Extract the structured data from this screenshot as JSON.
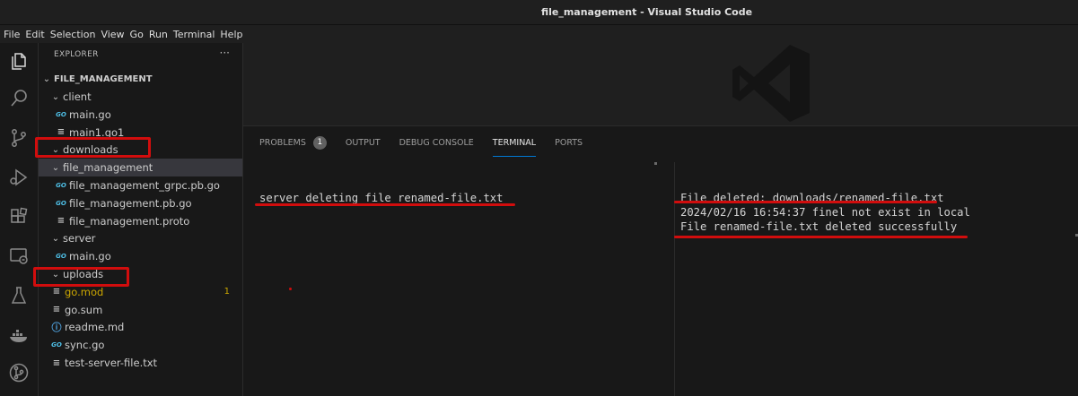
{
  "window": {
    "title": "file_management - Visual Studio Code"
  },
  "menu": [
    "File",
    "Edit",
    "Selection",
    "View",
    "Go",
    "Run",
    "Terminal",
    "Help"
  ],
  "activity_bar": [
    "explorer-icon",
    "search-icon",
    "source-control-icon",
    "run-debug-icon",
    "extensions-icon",
    "remote-explorer-icon",
    "testing-icon",
    "docker-icon",
    "git-graph-icon"
  ],
  "explorer": {
    "header": "EXPLORER",
    "more": "···",
    "root": "FILE_MANAGEMENT",
    "tree": [
      {
        "label": "client",
        "kind": "folder",
        "depth": 1,
        "open": true
      },
      {
        "label": "main.go",
        "kind": "go",
        "depth": 2
      },
      {
        "label": "main1.go1",
        "kind": "lines",
        "depth": 2
      },
      {
        "label": "downloads",
        "kind": "folder",
        "depth": 1,
        "open": true
      },
      {
        "label": "file_management",
        "kind": "folder",
        "depth": 1,
        "open": true,
        "selected": true
      },
      {
        "label": "file_management_grpc.pb.go",
        "kind": "go",
        "depth": 2
      },
      {
        "label": "file_management.pb.go",
        "kind": "go",
        "depth": 2
      },
      {
        "label": "file_management.proto",
        "kind": "lines",
        "depth": 2
      },
      {
        "label": "server",
        "kind": "folder",
        "depth": 1,
        "open": true
      },
      {
        "label": "main.go",
        "kind": "go",
        "depth": 2
      },
      {
        "label": "uploads",
        "kind": "folder",
        "depth": 1,
        "open": true
      },
      {
        "label": "go.mod",
        "kind": "lines",
        "depth": 1,
        "warn": true,
        "badge": "1"
      },
      {
        "label": "go.sum",
        "kind": "lines",
        "depth": 1
      },
      {
        "label": "readme.md",
        "kind": "info",
        "depth": 1
      },
      {
        "label": "sync.go",
        "kind": "go",
        "depth": 1
      },
      {
        "label": "test-server-file.txt",
        "kind": "lines",
        "depth": 1
      }
    ]
  },
  "panel": {
    "tabs": [
      {
        "label": "PROBLEMS",
        "badge": "1"
      },
      {
        "label": "OUTPUT"
      },
      {
        "label": "DEBUG CONSOLE"
      },
      {
        "label": "TERMINAL",
        "active": true
      },
      {
        "label": "PORTS"
      }
    ],
    "terminal_left": [
      "server deleting file renamed-file.txt"
    ],
    "terminal_right": [
      "File deleted: downloads/renamed-file.txt",
      "2024/02/16 16:54:37 finel not exist in local",
      "File renamed-file.txt deleted successfully"
    ]
  },
  "colors": {
    "accent": "#0078d4",
    "annotation": "#d10d0d",
    "warning": "#cca700",
    "go_icon": "#4fc1e9"
  }
}
